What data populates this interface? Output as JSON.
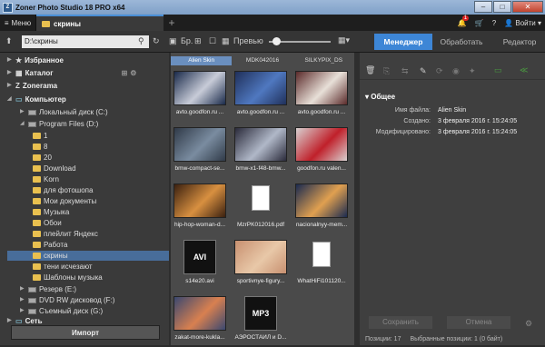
{
  "window": {
    "title": "Zoner Photo Studio 18 PRO x64",
    "app_icon": "Z",
    "minimize": "–",
    "maximize": "□",
    "close": "✕"
  },
  "tabs": {
    "menu_label": "Меню",
    "doc_tab_label": "скрины",
    "add_tab": "+"
  },
  "topbar": {
    "notification_count": "1",
    "login_label": "Войти",
    "help": "?"
  },
  "toolbar": {
    "path_value": "D:\\скрины",
    "browse_label": "Бр.",
    "preview_label": "Превью"
  },
  "modes": [
    {
      "label": "Менеджер",
      "active": true
    },
    {
      "label": "Обработать",
      "active": false
    },
    {
      "label": "Редактор",
      "active": false
    }
  ],
  "sidebar": {
    "items": [
      {
        "label": "Избранное",
        "type": "root"
      },
      {
        "label": "Каталог",
        "type": "root"
      },
      {
        "label": "Zonerama",
        "type": "root"
      },
      {
        "label": "Компьютер",
        "type": "root"
      },
      {
        "label": "Локальный диск (C:)",
        "type": "drive"
      },
      {
        "label": "Program Files (D:)",
        "type": "drive"
      },
      {
        "label": "1",
        "type": "folder"
      },
      {
        "label": "8",
        "type": "folder"
      },
      {
        "label": "20",
        "type": "folder"
      },
      {
        "label": "Download",
        "type": "folder"
      },
      {
        "label": "Korn",
        "type": "folder"
      },
      {
        "label": "для фотошопа",
        "type": "folder"
      },
      {
        "label": "Мои документы",
        "type": "folder"
      },
      {
        "label": "Музыка",
        "type": "folder"
      },
      {
        "label": "Обои",
        "type": "folder"
      },
      {
        "label": "плейлит Яндекс",
        "type": "folder"
      },
      {
        "label": "Работа",
        "type": "folder"
      },
      {
        "label": "скрины",
        "type": "folder",
        "selected": true
      },
      {
        "label": "тени исчезают",
        "type": "folder"
      },
      {
        "label": "Шаблоны музыка",
        "type": "folder"
      },
      {
        "label": "Резерв (E:)",
        "type": "drive"
      },
      {
        "label": "DVD RW дисковод (F:)",
        "type": "drive"
      },
      {
        "label": "Съемный диск (G:)",
        "type": "drive"
      },
      {
        "label": "Сеть",
        "type": "root"
      }
    ],
    "import_label": "Импорт"
  },
  "grid": {
    "column_tabs": [
      "Alien Skin",
      "MDK042016",
      "SILKYPIX_DS"
    ],
    "thumbs": [
      {
        "label": "avto.goodfon.ru ...",
        "color": "#1a2a4a",
        "accent": "#c8ccd8"
      },
      {
        "label": "avto.goodfon.ru ...",
        "color": "#20305a",
        "accent": "#4f78c0"
      },
      {
        "label": "avto.goodfon.ru ...",
        "color": "#5a2a2a",
        "accent": "#e8e0d8"
      },
      {
        "label": "bmw-compact-se...",
        "color": "#303a48",
        "accent": "#7a8ca0"
      },
      {
        "label": "bmw-x1-f48-bmw...",
        "color": "#2a2a3a",
        "accent": "#b0b8c8"
      },
      {
        "label": "goodfon.ru valen...",
        "color": "#d8d0d0",
        "accent": "#c0202a"
      },
      {
        "label": "hip-hop-woman-d...",
        "color": "#3a2010",
        "accent": "#d89040"
      },
      {
        "label": "MzrPK012016.pdf",
        "color": "doc",
        "accent": ""
      },
      {
        "label": "nacionalnyy-mem...",
        "color": "#1a2a50",
        "accent": "#e0a050"
      },
      {
        "label": "s14e20.avi",
        "color": "avi",
        "accent": ""
      },
      {
        "label": "sportivnye-figury...",
        "color": "#c89070",
        "accent": "#e8c8a8"
      },
      {
        "label": "WhatHiFi101120...",
        "color": "doc",
        "accent": ""
      },
      {
        "label": "zakat-more-kukla...",
        "color": "#3a4870",
        "accent": "#d88050"
      },
      {
        "label": "АЭРОСТАЙЛ и D...",
        "color": "mp3",
        "accent": ""
      }
    ]
  },
  "right_panel": {
    "section_title": "Общее",
    "props": [
      {
        "key": "Имя файла:",
        "value": "Alien Skin"
      },
      {
        "key": "Создано:",
        "value": "3 февраля 2016 г.  15:24:05"
      },
      {
        "key": "Модифицировано:",
        "value": "3 февраля 2016 г.  15:24:05"
      }
    ],
    "save_label": "Сохранить",
    "cancel_label": "Отмена"
  },
  "status": {
    "positions": "Позиции: 17",
    "selected": "Выбранные позиции: 1 (0 байт)"
  },
  "colors": {
    "accent": "#3d86d6",
    "folder": "#e9c04f"
  }
}
